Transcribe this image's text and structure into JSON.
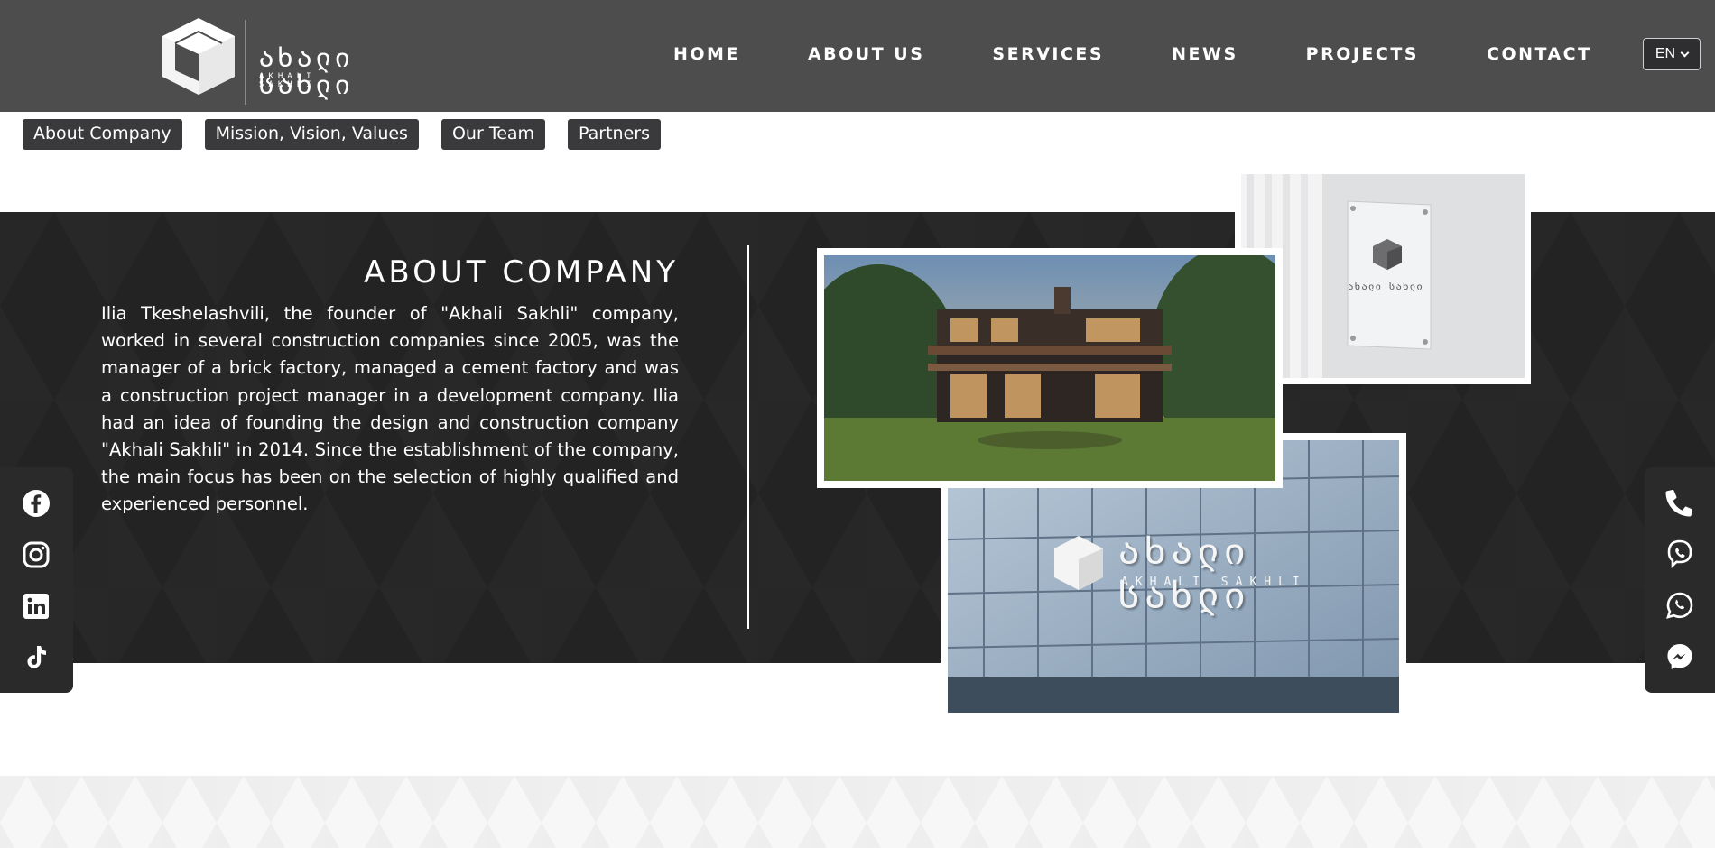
{
  "brand": {
    "name": "ახალი სახლი",
    "subname": "AKHALI SAKHLI"
  },
  "nav": {
    "items": [
      "HOME",
      "ABOUT US",
      "SERVICES",
      "NEWS",
      "PROJECTS",
      "CONTACT"
    ]
  },
  "language": {
    "selected": "EN"
  },
  "subnav": {
    "tabs": [
      "About Company",
      "Mission, Vision, Values",
      "Our Team",
      "Partners"
    ]
  },
  "about": {
    "title": "ABOUT COMPANY",
    "text": "Ilia Tkeshelashvili, the founder of \"Akhali Sakhli\" company, worked in several construction companies since 2005, was the manager of a brick factory, managed a cement factory and was a construction project manager in a development company. Ilia had an idea of founding the design and construction company \"Akhali Sakhli\" in 2014. Since the establishment of the company, the main focus has been on the selection of highly qualified and experienced personnel."
  },
  "photos": {
    "sign_word": "ახალი სახლი",
    "building_word": "ახალი სახლი",
    "building_sub": "AKHALI SAKHLI"
  },
  "social": {
    "icons": [
      "facebook-icon",
      "instagram-icon",
      "linkedin-icon",
      "tiktok-icon"
    ]
  },
  "contact": {
    "icons": [
      "phone-icon",
      "viber-icon",
      "whatsapp-icon",
      "messenger-icon"
    ]
  },
  "colors": {
    "header_bg": "#4d4d4e",
    "band_bg": "#232323",
    "tab_bg": "#3a3a3c",
    "text_light": "#ffffff"
  }
}
